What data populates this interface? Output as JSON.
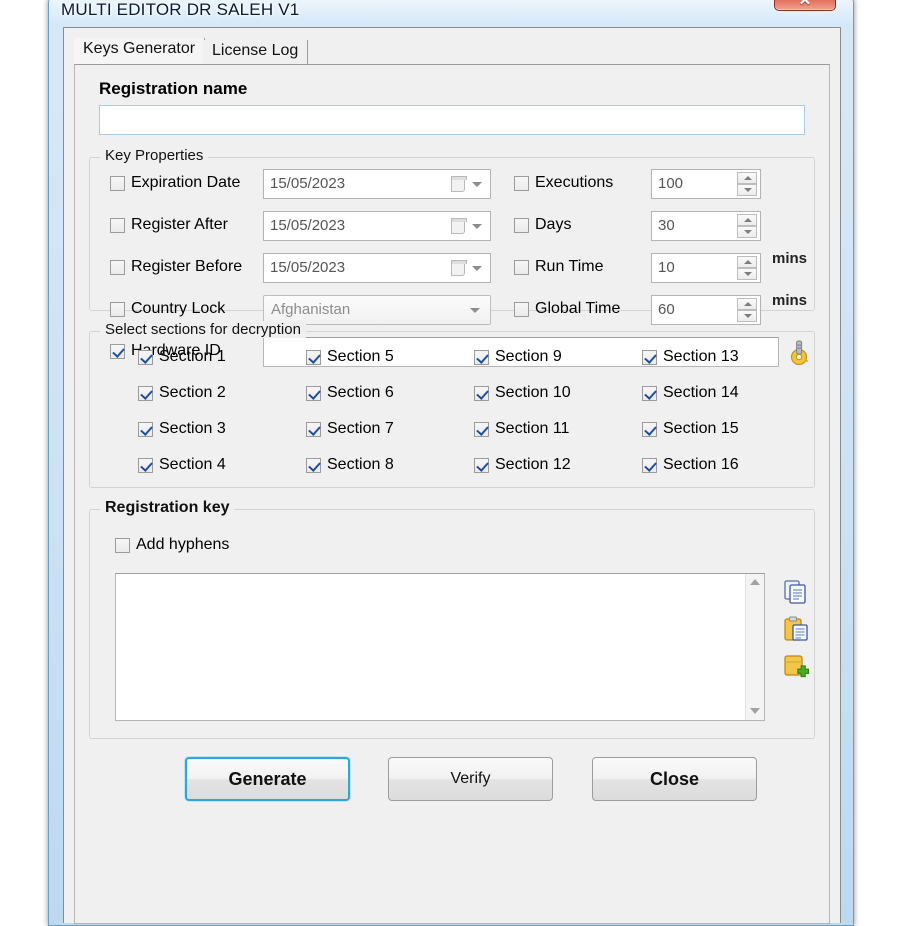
{
  "window": {
    "title": "MULTI EDITOR DR SALEH V1",
    "close_glyph": "✕"
  },
  "tabs": [
    {
      "label": "Keys Generator",
      "active": true
    },
    {
      "label": "License Log",
      "active": false
    }
  ],
  "registration_name": {
    "label": "Registration name",
    "value": "",
    "placeholder": ""
  },
  "key_properties": {
    "caption": "Key Properties",
    "left_rows": [
      {
        "label": "Expiration Date",
        "checked": false,
        "control": "date",
        "value": "15/05/2023"
      },
      {
        "label": "Register After",
        "checked": false,
        "control": "date",
        "value": "15/05/2023"
      },
      {
        "label": "Register Before",
        "checked": false,
        "control": "date",
        "value": "15/05/2023"
      },
      {
        "label": "Country Lock",
        "checked": false,
        "control": "combo",
        "value": "Afghanistan"
      },
      {
        "label": "Hardware ID",
        "checked": true,
        "control": "text",
        "value": ""
      }
    ],
    "right_rows": [
      {
        "label": "Executions",
        "checked": false,
        "value": "100",
        "unit": ""
      },
      {
        "label": "Days",
        "checked": false,
        "value": "30",
        "unit": ""
      },
      {
        "label": "Run Time",
        "checked": false,
        "value": "10",
        "unit": "mins"
      },
      {
        "label": "Global Time",
        "checked": false,
        "value": "60",
        "unit": "mins"
      }
    ],
    "hardware_id_icon": "key-icon"
  },
  "sections": {
    "caption": "Select sections for decryption",
    "items": [
      {
        "label": "Section 1",
        "checked": true
      },
      {
        "label": "Section 2",
        "checked": true
      },
      {
        "label": "Section 3",
        "checked": true
      },
      {
        "label": "Section 4",
        "checked": true
      },
      {
        "label": "Section 5",
        "checked": true
      },
      {
        "label": "Section 6",
        "checked": true
      },
      {
        "label": "Section 7",
        "checked": true
      },
      {
        "label": "Section 8",
        "checked": true
      },
      {
        "label": "Section 9",
        "checked": true
      },
      {
        "label": "Section 10",
        "checked": true
      },
      {
        "label": "Section 11",
        "checked": true
      },
      {
        "label": "Section 12",
        "checked": true
      },
      {
        "label": "Section 13",
        "checked": true
      },
      {
        "label": "Section 14",
        "checked": true
      },
      {
        "label": "Section 15",
        "checked": true
      },
      {
        "label": "Section 16",
        "checked": true
      }
    ]
  },
  "registration_key": {
    "caption": "Registration key",
    "add_hyphens_label": "Add hyphens",
    "add_hyphens_checked": false,
    "value": "",
    "icons": [
      "copy-icon",
      "paste-icon",
      "add-icon"
    ]
  },
  "buttons": {
    "generate": "Generate",
    "verify": "Verify",
    "close": "Close"
  },
  "colors": {
    "accent_focus": "#2fa5e0",
    "check_blue": "#1e4f9e",
    "close_red": "#c63a26",
    "window_chrome": "#cbe2f4"
  }
}
